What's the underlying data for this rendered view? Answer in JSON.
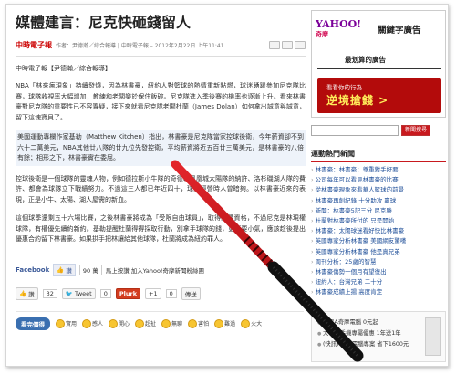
{
  "article": {
    "title": "媒體建言：尼克快砸錢留人",
    "byline_logo": "中時電子報",
    "byline_text": "作者：尹德瀚／綜合報導 | 中時電子報 – 2012年2月22日 上午11:41",
    "source": "中時電子報【尹德瀚／綜合報導】",
    "paragraphs": [
      "NBA「林來瘋現象」持續發燒，因為林書豪，紐約人對籃球的熱情重新點燃，球迷踴躍參加尼克隊比賽，球隊收視率大幅增加，教練和老闆樂於保住飯碗。尼克隊進入季後賽的機率也逐漸上升。看來林書豪對尼克隊的重要性已不容置疑，接下來就看尼克隊老闆杜蘭（James Dolan）如何拿出誠意與誠意，留下這塊寶貝了。",
      "美國運動專欄作家基勒（Matthew Kitchen）指出，林書豪是尼克隊當家控球後衛，今年薪資卻不到六十二萬美元，NBA其他廿八隊的廿九位先發控衛，平均薪資將近五百廿三萬美元，是林書豪的八倍有餘；相形之下，林書豪實在委屈。",
      "控球後衛是一個球隊的靈魂人物，例如德拉斯小牛隊的奇德、鳳凰城太陽隊的納許、洛杉磯湖人隊的費許、都會為球隊立下戰績努力。不過這三人都已年近四十，球隊經營時人曾暗夠。以林書豪近來的表現，正是小牛、太陽、湖人屋需的新血。",
      "這個球季還剩五十六場比賽，之後林書豪將成為「受限自由球員」，取得議價資格，不過尼克是林現權球隊，有權優先續約新約。基勒提醒杜蘭得得採取行動，別拿手球隊的錢，更不要小氣，應該趁後提出優惠合約留下林書豪。如果拱手把林讓給其他球隊，杜蘭將成為紐約罪人。"
    ]
  },
  "facebook": {
    "label": "Facebook",
    "like": "讚",
    "count": "90 萬",
    "text": "馬上按讚 加入Yahoo!奇摩新聞粉絲團"
  },
  "share": {
    "like": "讚",
    "like_count": "32",
    "tweet": "Tweet",
    "tweet_count": "0",
    "plurk": "Plurk",
    "gplus": "+1",
    "gplus_count": "0",
    "send": "傳送"
  },
  "moods": {
    "label": "看完價得",
    "items": [
      "實用",
      "感人",
      "開心",
      "超扯",
      "無聊",
      "害怕",
      "難過",
      "火大"
    ]
  },
  "sidebar": {
    "ad": {
      "brand": "YAHOO!",
      "brand_sub": "奇摩",
      "title": "關鍵字廣告",
      "slogan": "最划算的廣告",
      "promo_line": "看看你的行為",
      "promo_big": "逆境搶錢 >"
    },
    "search_placeholder": "",
    "search_button": "新聞搜尋",
    "news_title": "運動熱門新聞",
    "news_items": [
      "林書豪：林書豪：尊重對手好要",
      "公司每年可以看見林書豪的比賽",
      "從林書豪現象來看華人籃球的前景",
      "林書豪再創紀錄 十分助攻 贏球",
      "新聞：林書豪5記三分 尼克勝",
      "杜蘭對林書豪所付的 只是開始",
      "林書豪：太陽球迷看好快比林書豪",
      "英國專家分析林書豪 美國網友驚嘆",
      "英國專家分析林書豪 他是真兄弟",
      "周刊分析：25歲的智慧",
      "林書豪傷勢一個月有望復出",
      "紐約人：台灣兄弟 二十分",
      "林書豪成績上揚 高度肯定"
    ],
    "promo_items": [
      "全民A奇摩電腦 0元起",
      "大哥大手機專屬優惠 1年送1年",
      "(快訊) 學生電腦專案 省下1600元"
    ]
  }
}
